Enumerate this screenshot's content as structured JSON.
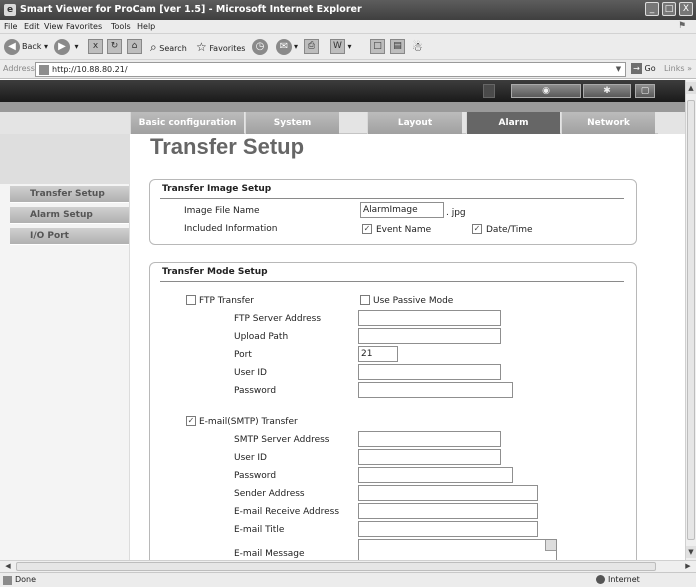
{
  "window": {
    "title": "Smart Viewer for ProCam [ver 1.5] - Microsoft Internet Explorer",
    "buttons": [
      "_",
      "□",
      "X"
    ]
  },
  "menu": [
    "File",
    "Edit",
    "View",
    "Favorites",
    "Tools",
    "Help"
  ],
  "toolbar": {
    "back": "Back",
    "search": "Search",
    "favorites": "Favorites"
  },
  "address": {
    "label": "Address",
    "url": "http://10.88.80.21/",
    "go": "Go",
    "links": "Links"
  },
  "status": {
    "text": "Done",
    "zone": "Internet"
  },
  "tabs": [
    {
      "label": "Basic configuration",
      "active": false
    },
    {
      "label": "System",
      "active": false
    },
    {
      "label": "Layout",
      "active": false
    },
    {
      "label": "Alarm",
      "active": true
    },
    {
      "label": "Network",
      "active": false
    }
  ],
  "sidebar": [
    "Transfer Setup",
    "Alarm Setup",
    "I/O Port"
  ],
  "page_title": "Transfer Setup",
  "image_setup": {
    "header": "Transfer Image Setup",
    "file_name_label": "Image File Name",
    "file_name_value": "AlarmImage",
    "file_ext": ". jpg",
    "included_label": "Included Information",
    "event_name": {
      "label": "Event Name",
      "checked": true
    },
    "date_time": {
      "label": "Date/Time",
      "checked": true
    }
  },
  "mode_setup": {
    "header": "Transfer Mode Setup",
    "ftp": {
      "label": "FTP Transfer",
      "checked": false,
      "passive_label": "Use Passive Mode",
      "passive_checked": false,
      "server_label": "FTP Server Address",
      "server_value": "",
      "path_label": "Upload Path",
      "path_value": "",
      "port_label": "Port",
      "port_value": "21",
      "user_label": "User ID",
      "user_value": "",
      "password_label": "Password",
      "password_value": ""
    },
    "smtp": {
      "label": "E-mail(SMTP) Transfer",
      "checked": true,
      "server_label": "SMTP Server Address",
      "user_label": "User ID",
      "password_label": "Password",
      "sender_label": "Sender Address",
      "receive_label": "E-mail Receive Address",
      "title_label": "E-mail Title",
      "message_label": "E-mail Message"
    }
  },
  "check_mark": "✓"
}
